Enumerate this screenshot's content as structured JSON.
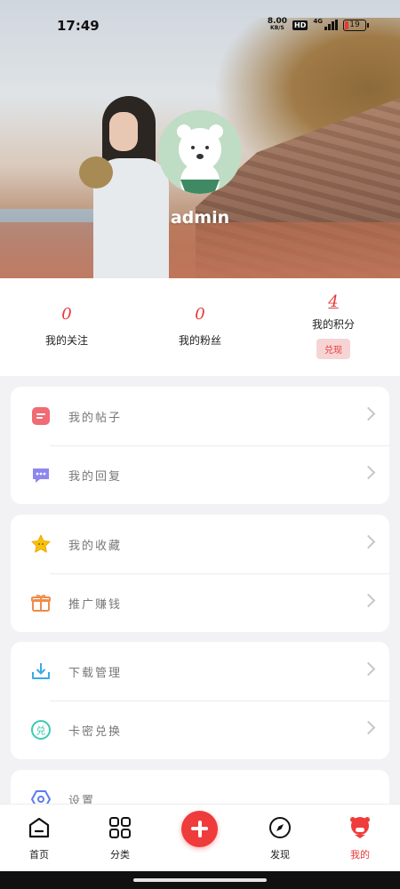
{
  "status_bar": {
    "time": "17:49",
    "speed_value": "8.00",
    "speed_unit": "KB/S",
    "hd": "HD",
    "network": "4G",
    "battery": "19"
  },
  "profile": {
    "username": "admin"
  },
  "stats": [
    {
      "value": "0",
      "label": "我的关注"
    },
    {
      "value": "0",
      "label": "我的粉丝"
    },
    {
      "value": "4",
      "label": "我的积分",
      "button": "兑现"
    }
  ],
  "menu_groups": [
    [
      {
        "label": "我的帖子",
        "icon": "post-icon"
      },
      {
        "label": "我的回复",
        "icon": "reply-icon"
      }
    ],
    [
      {
        "label": "我的收藏",
        "icon": "star-icon"
      },
      {
        "label": "推广赚钱",
        "icon": "gift-icon"
      }
    ],
    [
      {
        "label": "下载管理",
        "icon": "download-icon"
      },
      {
        "label": "卡密兑换",
        "icon": "exchange-icon"
      }
    ],
    [
      {
        "label": "设置",
        "icon": "settings-icon"
      }
    ]
  ],
  "tabbar": {
    "home": "首页",
    "category": "分类",
    "discover": "发现",
    "mine": "我的"
  },
  "colors": {
    "accent": "#e53a3a",
    "post_icon": "#f06b74",
    "reply_icon": "#8f87f0",
    "star_icon": "#f7c20d",
    "gift_icon": "#f28b4a",
    "download_icon": "#3aa9e8",
    "exchange_icon": "#3cc9b4",
    "settings_icon": "#5b7cf2"
  }
}
